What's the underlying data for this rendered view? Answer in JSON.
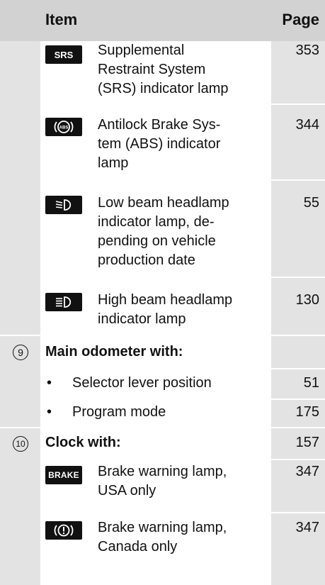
{
  "header": {
    "item": "Item",
    "page": "Page"
  },
  "rows": [
    {
      "badge": "SRS",
      "icon": "srs-icon",
      "text": "Supplemental\nRestraint System\n(SRS) indicator lamp",
      "page": "353"
    },
    {
      "icon": "abs-icon",
      "text": "Antilock Brake Sys-\ntem (ABS) indicator\nlamp",
      "page": "344"
    },
    {
      "icon": "low-beam-icon",
      "text": "Low beam headlamp\nindicator lamp, de-\npending on vehicle\nproduction date",
      "page": "55"
    },
    {
      "icon": "high-beam-icon",
      "text": "High beam headlamp\nindicator lamp",
      "page": "130"
    }
  ],
  "section9": {
    "number": "9",
    "title": "Main odometer with:",
    "bullets": [
      {
        "text": "Selector lever position",
        "page": "51"
      },
      {
        "text": "Program mode",
        "page": "175"
      }
    ]
  },
  "section10": {
    "number": "10",
    "title": "Clock with:",
    "page": "157",
    "rows": [
      {
        "badge": "BRAKE",
        "icon": "brake-text-icon",
        "text": "Brake warning lamp,\nUSA only",
        "page": "347"
      },
      {
        "icon": "brake-warning-icon",
        "text": "Brake warning lamp,\nCanada only",
        "page": "347"
      }
    ]
  },
  "colors": {
    "header_bg": "#d2d2d2",
    "column_bg": "#e3e3e3",
    "badge_bg": "#111111"
  }
}
